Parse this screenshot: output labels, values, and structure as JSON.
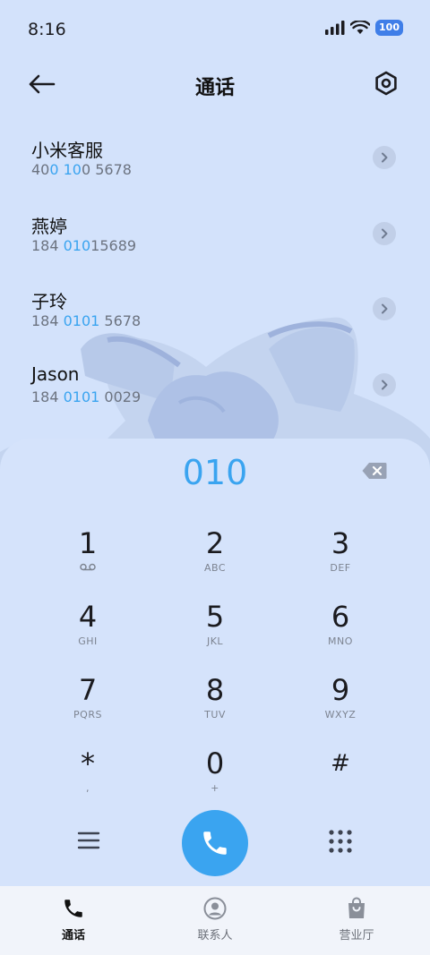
{
  "status_bar": {
    "time": "8:16",
    "battery": "100"
  },
  "header": {
    "title": "通话"
  },
  "contacts": [
    {
      "name": "小米客服",
      "number_parts": [
        "40",
        "0 10",
        "0 5678"
      ]
    },
    {
      "name": "燕婷",
      "number_parts": [
        "184 ",
        "010",
        "15689"
      ]
    },
    {
      "name": "子玲",
      "number_parts": [
        "184 ",
        "0101",
        " 5678"
      ]
    },
    {
      "name": "Jason",
      "number_parts": [
        "184 ",
        "0101",
        " 0029"
      ]
    }
  ],
  "dialer": {
    "input": "010",
    "keys": [
      {
        "digit": "1",
        "sub": ""
      },
      {
        "digit": "2",
        "sub": "ABC"
      },
      {
        "digit": "3",
        "sub": "DEF"
      },
      {
        "digit": "4",
        "sub": "GHI"
      },
      {
        "digit": "5",
        "sub": "JKL"
      },
      {
        "digit": "6",
        "sub": "MNO"
      },
      {
        "digit": "7",
        "sub": "PQRS"
      },
      {
        "digit": "8",
        "sub": "TUV"
      },
      {
        "digit": "9",
        "sub": "WXYZ"
      },
      {
        "digit": "*",
        "sub": ","
      },
      {
        "digit": "0",
        "sub": "+"
      },
      {
        "digit": "#",
        "sub": ""
      }
    ]
  },
  "bottom_nav": {
    "items": [
      {
        "label": "通话",
        "icon": "phone-icon",
        "active": true
      },
      {
        "label": "联系人",
        "icon": "person-icon",
        "active": false
      },
      {
        "label": "营业厅",
        "icon": "shopping-bag-icon",
        "active": false
      }
    ]
  },
  "colors": {
    "background": "#d3e2fb",
    "accent": "#3aa4f0",
    "nav_background": "#f1f4fa"
  }
}
